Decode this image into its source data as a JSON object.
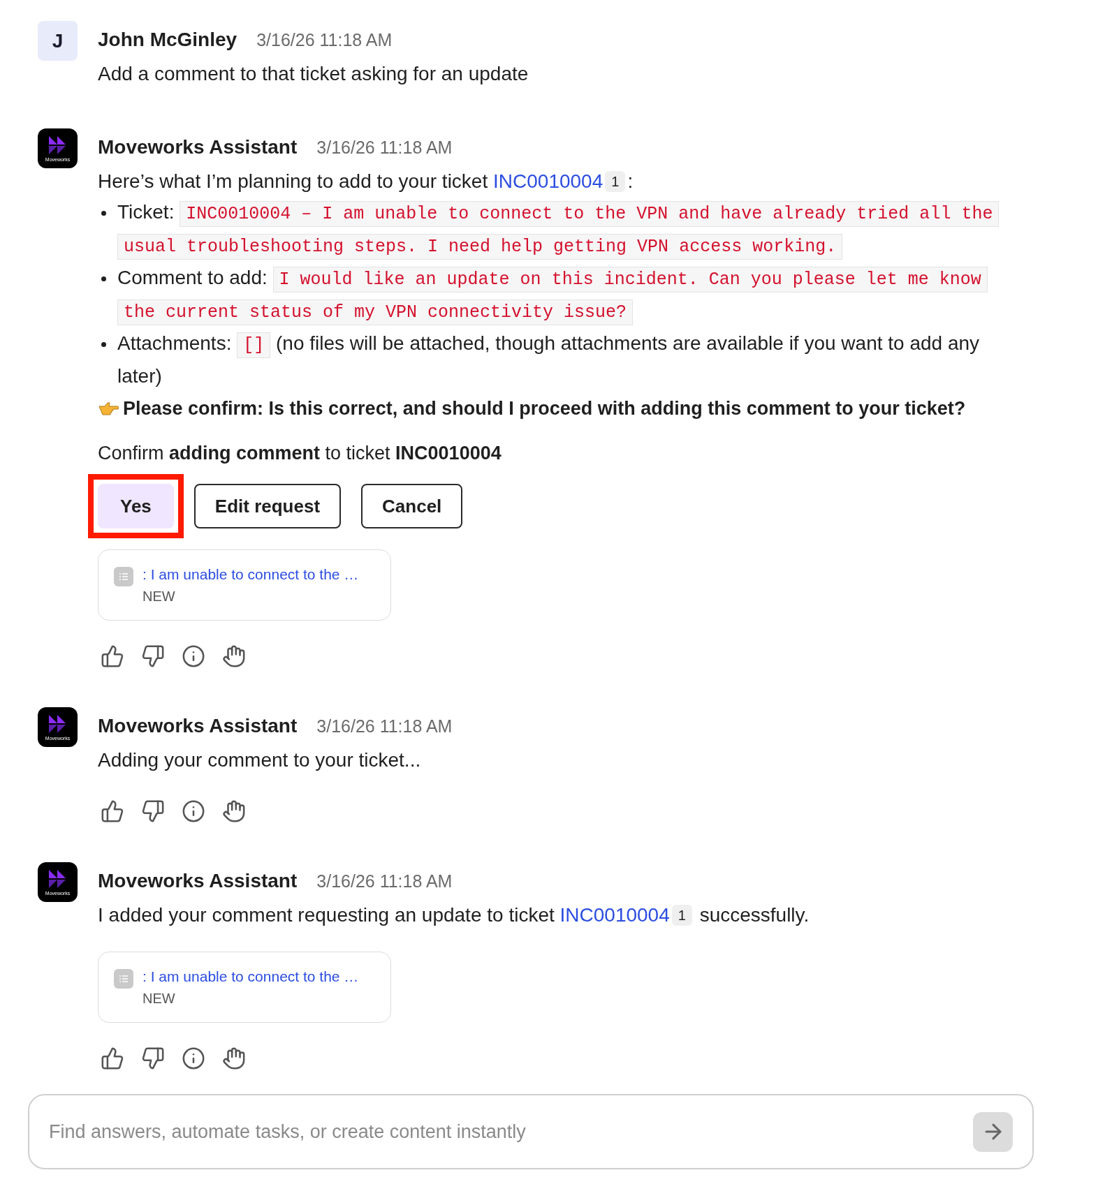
{
  "messages": [
    {
      "author": "John McGinley",
      "timestamp": "3/16/26 11:18 AM",
      "avatar": {
        "kind": "letter",
        "text": "J"
      },
      "feedback": false,
      "blocks": [
        {
          "kind": "text",
          "parts": [
            {
              "kind": "plain",
              "text": "Add a comment to that ticket asking for an update"
            }
          ]
        }
      ]
    },
    {
      "author": "Moveworks Assistant",
      "timestamp": "3/16/26 11:18 AM",
      "avatar": {
        "kind": "logo",
        "text": "Moveworks"
      },
      "feedback": true,
      "blocks": [
        {
          "kind": "text",
          "parts": [
            {
              "kind": "plain",
              "text": "Here’s what I’m planning to add to your ticket "
            },
            {
              "kind": "link",
              "text": "INC0010004"
            },
            {
              "kind": "badge",
              "text": "1"
            },
            {
              "kind": "plain",
              "text": ":"
            }
          ]
        },
        {
          "kind": "bullets",
          "items": [
            {
              "label": "Ticket:",
              "code": "INC0010004 – I am unable to connect to the VPN and have already tried all the usual troubleshooting steps. I need help getting VPN access working."
            },
            {
              "label": "Comment to add:",
              "code": "I would like an update on this incident. Can you please let me know the current status of my VPN connectivity issue?"
            },
            {
              "label": "Attachments:",
              "code": "[]",
              "after": "(no files will be attached, though attachments are available if you want to add any later)"
            }
          ]
        },
        {
          "kind": "note",
          "text": "Please confirm: Is this correct, and should I proceed with adding this comment to your ticket?"
        },
        {
          "kind": "prompt",
          "text": "Confirm **adding comment** to ticket **INC0010004**"
        },
        {
          "kind": "buttons",
          "items": [
            {
              "label": "Yes",
              "primary": true,
              "highlighted": true
            },
            {
              "label": "Edit request",
              "primary": false,
              "highlighted": false
            },
            {
              "label": "Cancel",
              "primary": false,
              "highlighted": false
            }
          ]
        },
        {
          "kind": "card",
          "title": ": I am unable to connect to the …",
          "status": "NEW"
        }
      ]
    },
    {
      "author": "Moveworks Assistant",
      "timestamp": "3/16/26 11:18 AM",
      "avatar": {
        "kind": "logo",
        "text": "Moveworks"
      },
      "feedback": true,
      "blocks": [
        {
          "kind": "text",
          "parts": [
            {
              "kind": "plain",
              "text": "Adding your comment to your ticket..."
            }
          ]
        }
      ]
    },
    {
      "author": "Moveworks Assistant",
      "timestamp": "3/16/26 11:18 AM",
      "avatar": {
        "kind": "logo",
        "text": "Moveworks"
      },
      "feedback": true,
      "blocks": [
        {
          "kind": "text",
          "parts": [
            {
              "kind": "plain",
              "text": "I added your comment requesting an update to ticket "
            },
            {
              "kind": "link",
              "text": "INC0010004"
            },
            {
              "kind": "badge",
              "text": "1"
            },
            {
              "kind": "plain",
              "text": " successfully."
            }
          ]
        },
        {
          "kind": "card",
          "title": ": I am unable to connect to the …",
          "status": "NEW"
        }
      ]
    }
  ],
  "composer": {
    "placeholder": "Find answers, automate tasks, or create content instantly"
  }
}
